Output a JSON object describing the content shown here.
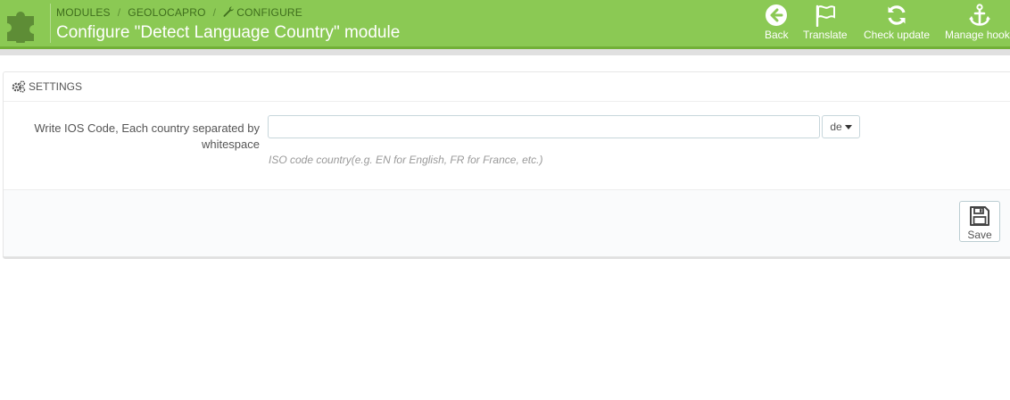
{
  "colors": {
    "header_bg": "#8bc954",
    "header_text": "#ffffff",
    "breadcrumb_text": "#3f6e1d",
    "panel_border": "#e6e6e6"
  },
  "header": {
    "breadcrumb": [
      "MODULES",
      "GEOLOCAPRO",
      "CONFIGURE"
    ],
    "breadcrumb_separator": "/",
    "title": "Configure \"Detect Language Country\" module",
    "toolbar": [
      {
        "label": "Back",
        "icon": "back-arrow-circle-icon"
      },
      {
        "label": "Translate",
        "icon": "flag-icon"
      },
      {
        "label": "Check update",
        "icon": "refresh-icon"
      },
      {
        "label": "Manage hooks",
        "icon": "anchor-icon"
      }
    ]
  },
  "panel": {
    "heading": "SETTINGS",
    "heading_icon": "gears-icon",
    "field": {
      "label": "Write IOS Code, Each country separated by whitespace",
      "value": "",
      "placeholder": "",
      "language": "de",
      "help": "ISO code country(e.g. EN for English, FR for France, etc.)"
    },
    "save_label": "Save",
    "save_icon": "floppy-disk-icon"
  }
}
